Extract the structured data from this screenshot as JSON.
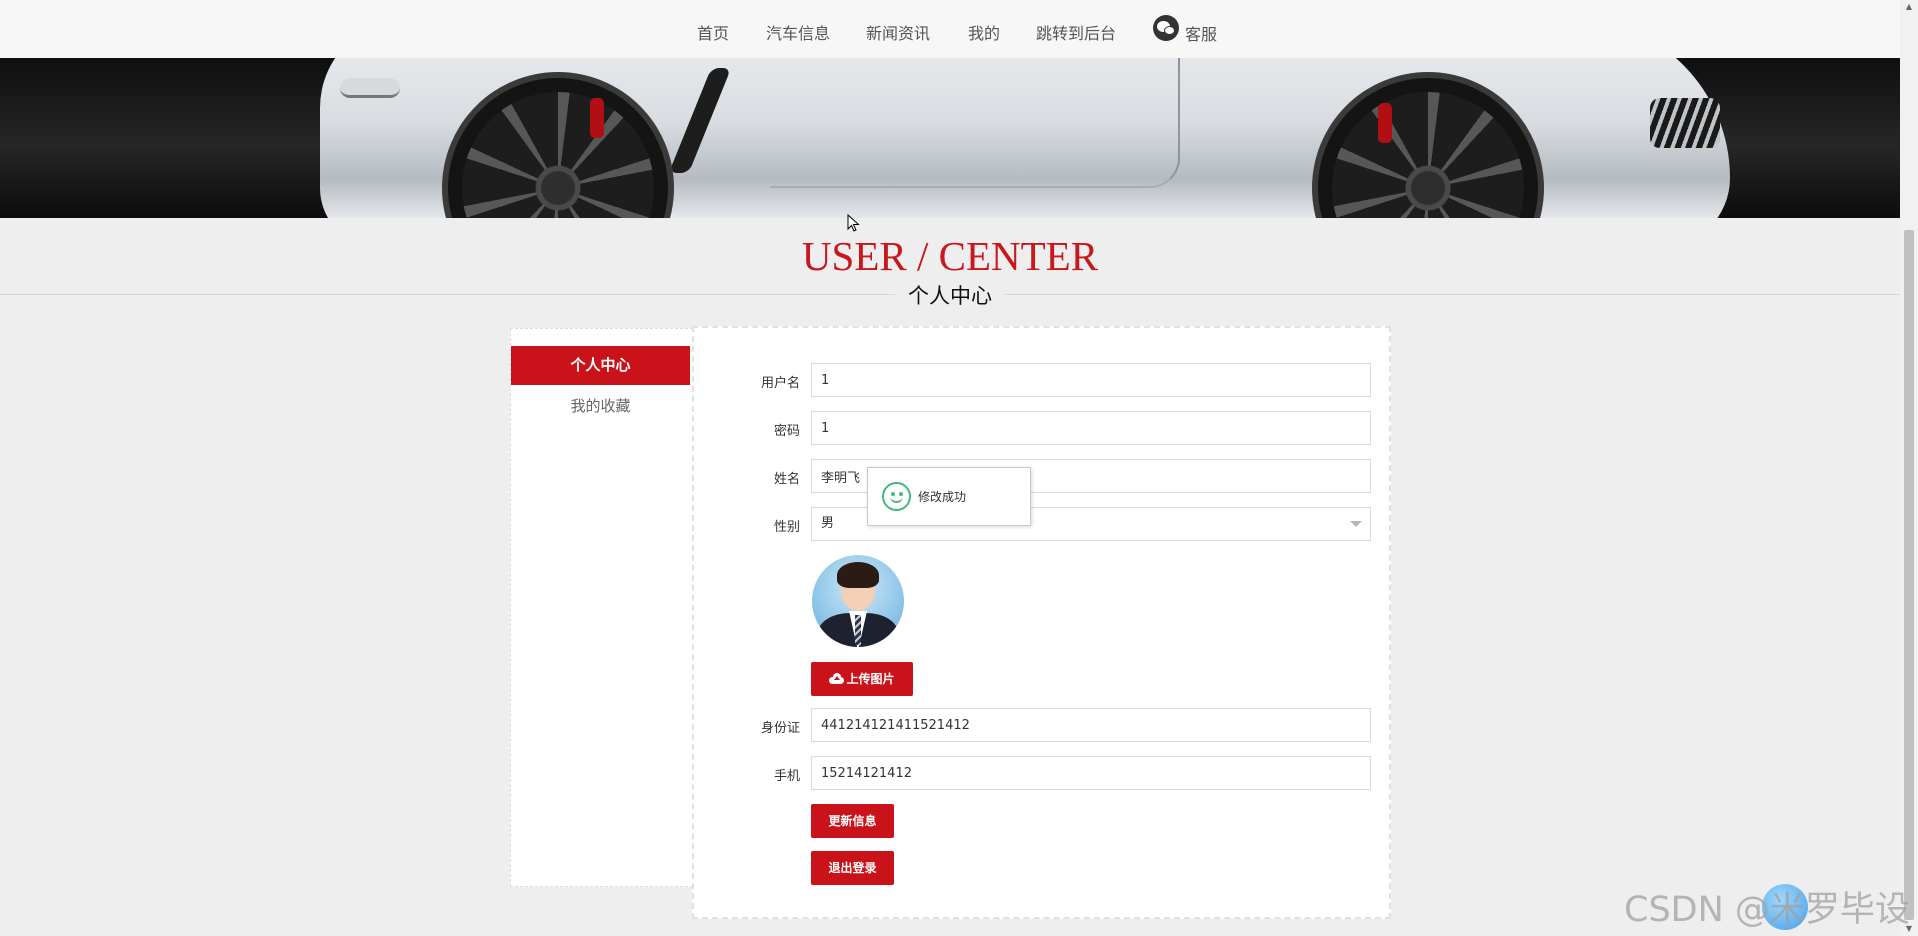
{
  "nav": {
    "items": [
      "首页",
      "汽车信息",
      "新闻资讯",
      "我的",
      "跳转到后台"
    ],
    "service_label": "客服"
  },
  "heading": {
    "en": "USER / CENTER",
    "cn": "个人中心"
  },
  "side_menu": {
    "items": [
      "个人中心",
      "我的收藏"
    ],
    "active": "个人中心"
  },
  "form": {
    "fields": [
      {
        "label": "用户名",
        "value": "1"
      },
      {
        "label": "密码",
        "value": "1"
      },
      {
        "label": "姓名",
        "value": "李明飞"
      },
      {
        "label": "性别",
        "value": "男"
      }
    ],
    "upload_button": "上传图片",
    "id_card": {
      "label": "身份证",
      "value": "441214121411521412"
    },
    "phone": {
      "label": "手机",
      "value": "15214121412"
    },
    "update_button": "更新信息",
    "logout_button": "退出登录"
  },
  "toast": {
    "message": "修改成功"
  },
  "watermark": "CSDN @米罗毕设",
  "colors": {
    "accent": "#c9121a",
    "heading_red": "#c8171d",
    "toast_icon": "#41b883",
    "page_bg": "#eeeeee"
  }
}
